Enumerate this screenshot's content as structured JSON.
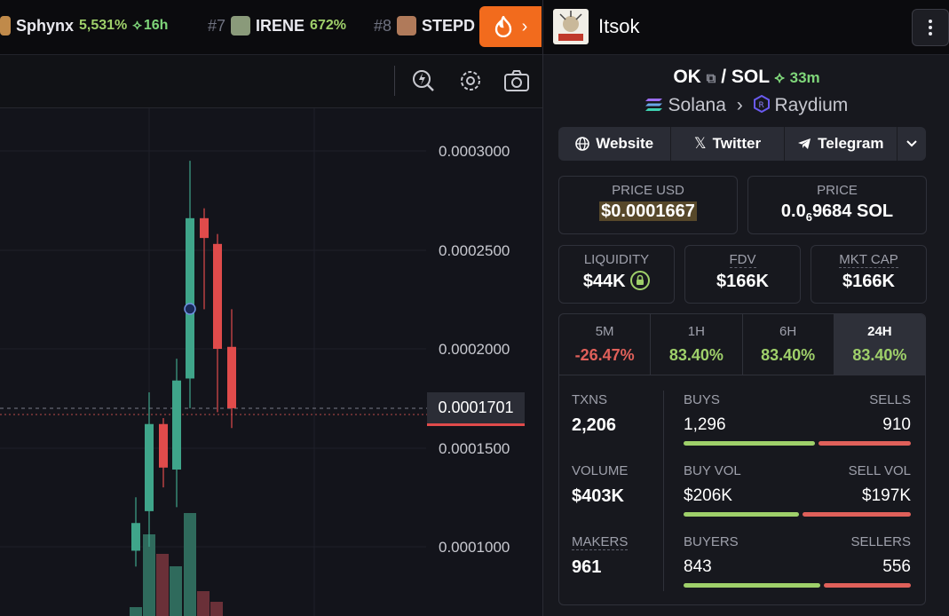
{
  "ticker": [
    {
      "rank": "",
      "name": "Sphynx",
      "pct": "5,531%",
      "age": "16h"
    },
    {
      "rank": "#7",
      "name": "IRENE",
      "pct": "672%",
      "age": ""
    },
    {
      "rank": "#8",
      "name": "STEPD",
      "pct": "",
      "age": ""
    }
  ],
  "colors": {
    "accent": "#f26b1d",
    "green": "#9fd06a",
    "red": "#e0605a",
    "candle_up": "#3fa58a",
    "candle_down": "#e04b4b"
  },
  "chart": {
    "axis_labels": [
      "0.0003000",
      "0.0002500",
      "0.0002000",
      "0.0001500",
      "0.0001000"
    ],
    "current_price": "0.0001701"
  },
  "chart_data": {
    "type": "candlestick",
    "ylim": [
      8e-05,
      0.00032
    ],
    "candles": [
      {
        "open": 9.8e-05,
        "close": 0.000112,
        "high": 0.000125,
        "low": 9e-05
      },
      {
        "open": 0.000118,
        "close": 0.000162,
        "high": 0.000178,
        "low": 0.0001
      },
      {
        "open": 0.000162,
        "close": 0.00014,
        "high": 0.000165,
        "low": 0.00013
      },
      {
        "open": 0.000139,
        "close": 0.000184,
        "high": 0.000195,
        "low": 0.00012
      },
      {
        "open": 0.000185,
        "close": 0.000266,
        "high": 0.000295,
        "low": 0.00017
      },
      {
        "open": 0.000266,
        "close": 0.000256,
        "high": 0.000271,
        "low": 0.00022
      },
      {
        "open": 0.000253,
        "close": 0.0002,
        "high": 0.000258,
        "low": 0.000168
      },
      {
        "open": 0.000201,
        "close": 0.00017,
        "high": 0.00022,
        "low": 0.00016
      }
    ]
  },
  "panel": {
    "token_name": "Itsok",
    "pair_base": "OK",
    "pair_quote": "SOL",
    "pair_age": "33m",
    "chain": "Solana",
    "dex": "Raydium",
    "links": {
      "website": "Website",
      "twitter": "Twitter",
      "telegram": "Telegram"
    },
    "price_usd_label": "PRICE USD",
    "price_usd": "$0.0001667",
    "price_label": "PRICE",
    "price_sol_prefix": "0.0",
    "price_sol_zeros": "6",
    "price_sol_rest": "9684 SOL",
    "liquidity_label": "LIQUIDITY",
    "liquidity": "$44K",
    "fdv_label": "FDV",
    "fdv": "$166K",
    "mktcap_label": "MKT CAP",
    "mktcap": "$166K",
    "tabs": [
      {
        "label": "5M",
        "value": "-26.47%",
        "color": "#e0605a"
      },
      {
        "label": "1H",
        "value": "83.40%",
        "color": "#9fd06a"
      },
      {
        "label": "6H",
        "value": "83.40%",
        "color": "#9fd06a"
      },
      {
        "label": "24H",
        "value": "83.40%",
        "color": "#9fd06a"
      }
    ],
    "stats": {
      "txns_label": "TXNS",
      "txns": "2,206",
      "buys_label": "BUYS",
      "buys": "1,296",
      "sells_label": "SELLS",
      "sells": "910",
      "volume_label": "VOLUME",
      "volume": "$403K",
      "buy_vol_label": "BUY VOL",
      "buy_vol": "$206K",
      "sell_vol_label": "SELL VOL",
      "sell_vol": "$197K",
      "makers_label": "MAKERS",
      "makers": "961",
      "buyers_label": "BUYERS",
      "buyers": "843",
      "sellers_label": "SELLERS",
      "sellers": "556"
    }
  }
}
